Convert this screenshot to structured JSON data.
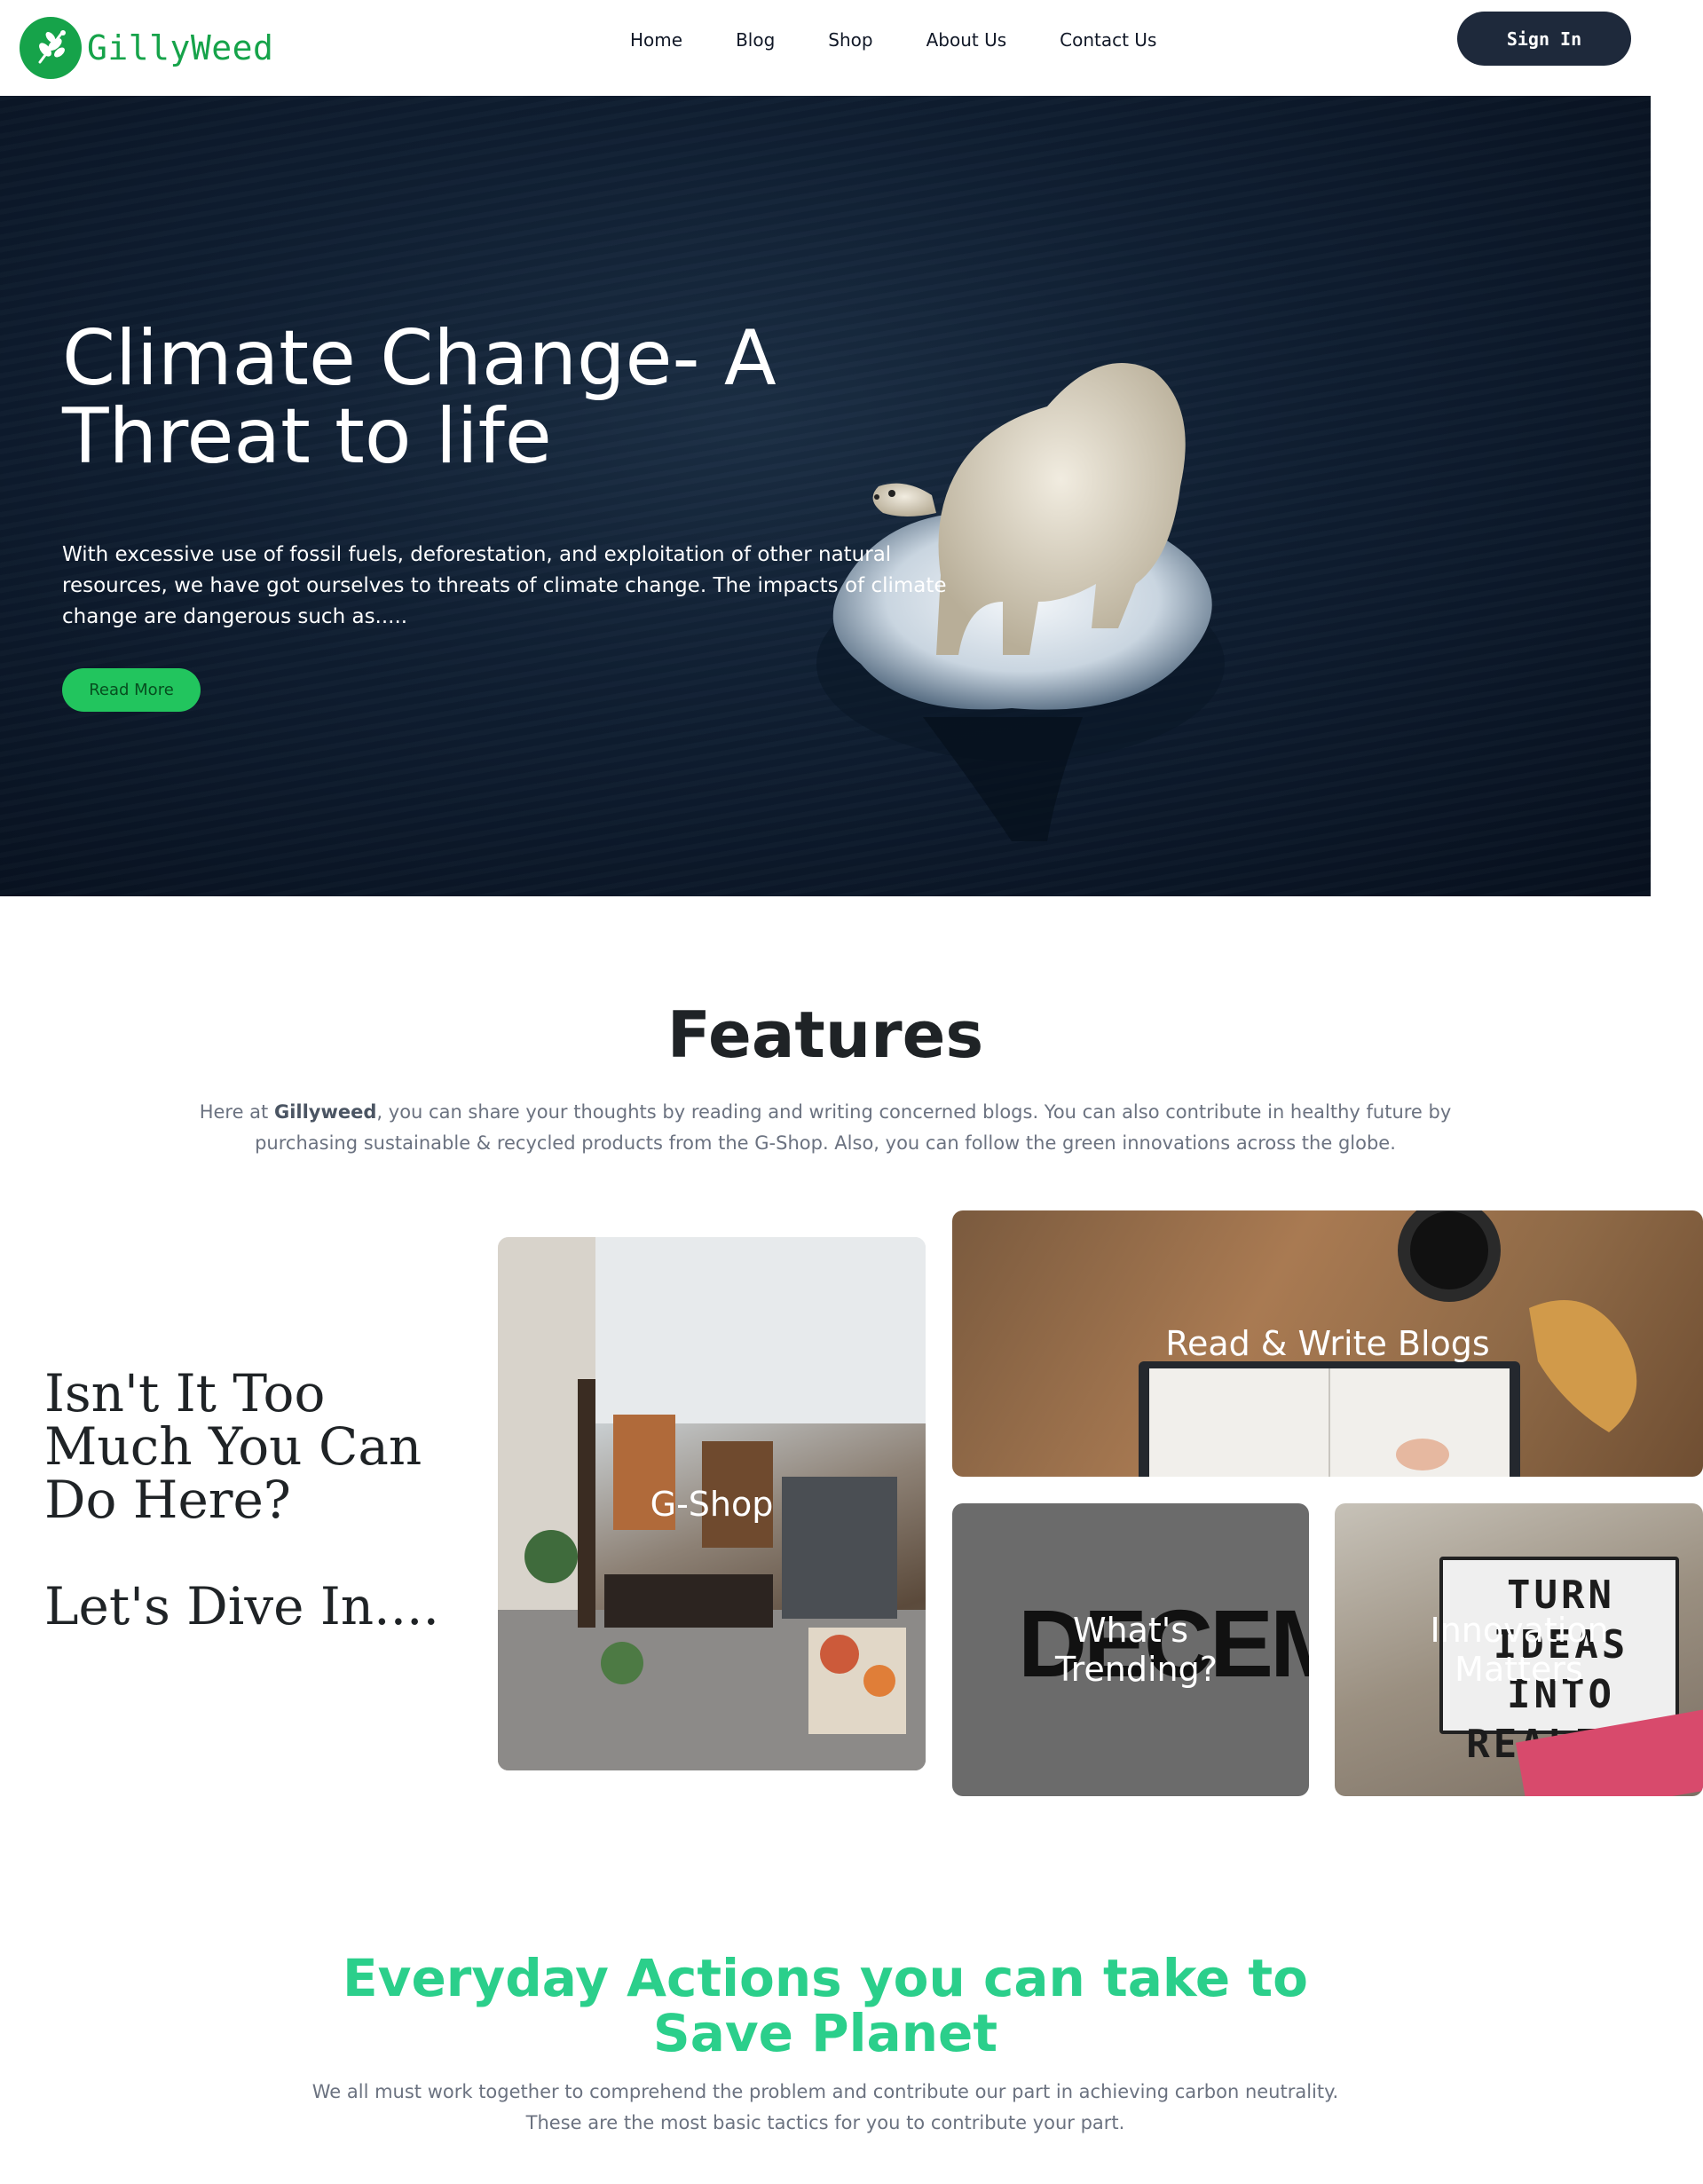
{
  "brand": {
    "name": "GillyWeed",
    "logo_icon": "leaf-icon",
    "color": "#16a34a"
  },
  "nav": {
    "links": [
      "Home",
      "Blog",
      "Shop",
      "About Us",
      "Contact Us"
    ],
    "signin_label": "Sign In"
  },
  "hero": {
    "title": "Climate Change- A Threat to life",
    "text": "With excessive use of fossil fuels, deforestation, and exploitation of other natural resources, we have got ourselves to threats of climate change. The impacts of climate change are dangerous such as.....",
    "button_label": "Read More",
    "accent": "#22c55e"
  },
  "features": {
    "title": "Features",
    "desc_prefix": "Here at ",
    "desc_brand": "Gillyweed",
    "desc_rest": ", you can share your thoughts by reading and writing concerned blogs. You can also contribute in healthy future by purchasing sustainable & recycled products from the G-Shop. Also, you can follow the green innovations across the globe.",
    "side_heading": "Isn't It Too Much You Can Do Here?",
    "side_subheading": "Let's Dive In....",
    "cards": [
      {
        "label": "G-Shop"
      },
      {
        "label": "Read & Write Blogs"
      },
      {
        "label": "What's Trending?",
        "image_text": "DECEMBER"
      },
      {
        "label": "Innovation Matters",
        "image_text": "TURN IDEAS INTO REALITY"
      }
    ]
  },
  "actions": {
    "title": "Everyday Actions you can take to Save Planet",
    "desc": "We all must work together to comprehend the problem and contribute our part in achieving carbon neutrality. These are the most basic tactics for you to contribute your part.",
    "color": "#2bcf8b"
  }
}
